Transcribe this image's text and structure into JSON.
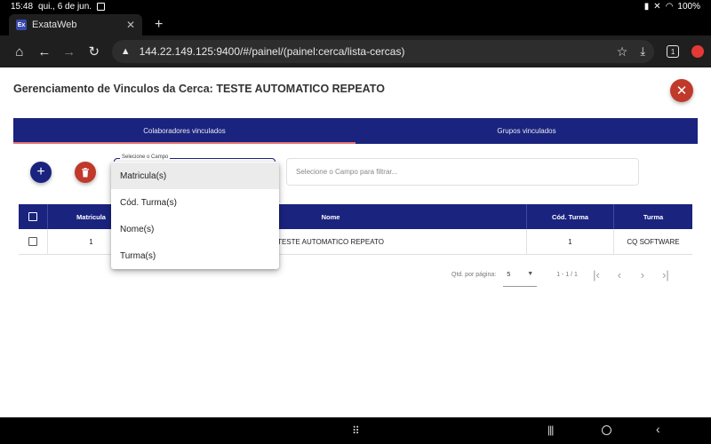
{
  "status_bar": {
    "time": "15:48",
    "date": "qui., 6 de jun.",
    "battery": "100%"
  },
  "browser": {
    "tab_title": "ExataWeb",
    "tab_favicon": "Ex",
    "url": "144.22.149.125:9400/#/painel/(painel:cerca/lista-cercas)",
    "tab_count": "1"
  },
  "page": {
    "title": "Gerenciamento de Vinculos da Cerca: TESTE AUTOMATICO REPEATO",
    "tabs": [
      {
        "label": "Colaboradores vinculados",
        "active": true
      },
      {
        "label": "Grupos vinculados",
        "active": false
      }
    ],
    "select_label": "Selecione o Campo",
    "filter_placeholder": "Selecione o Campo para filtrar...",
    "dropdown_options": [
      "Matricula(s)",
      "Cód. Turma(s)",
      "Nome(s)",
      "Turma(s)"
    ],
    "table": {
      "headers": {
        "matricula": "Matricula",
        "nome": "Nome",
        "cod_turma": "Cód. Turma",
        "turma": "Turma"
      },
      "rows": [
        {
          "matricula": "1",
          "nome": "TESTE AUTOMATICO REPEATO",
          "cod_turma": "1",
          "turma": "CQ SOFTWARE"
        }
      ]
    },
    "paginator": {
      "label": "Qtd. por página:",
      "page_size": "5",
      "range": "1 - 1 / 1"
    }
  },
  "colors": {
    "primary": "#1a237e",
    "danger": "#c0392b",
    "tab_indicator": "#e57373"
  }
}
